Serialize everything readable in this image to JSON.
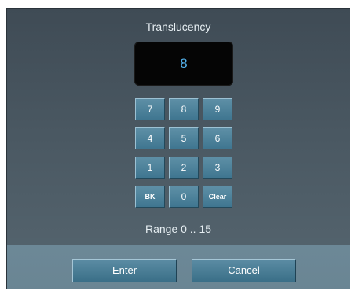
{
  "dialog": {
    "title": "Translucency",
    "display_value": "8",
    "range_text": "Range 0 .. 15"
  },
  "keypad": {
    "keys": [
      "7",
      "8",
      "9",
      "4",
      "5",
      "6",
      "1",
      "2",
      "3",
      "BK",
      "0",
      "Clear"
    ]
  },
  "footer": {
    "enter_label": "Enter",
    "cancel_label": "Cancel"
  },
  "colors": {
    "display_text": "#55b4ee",
    "key_face": "#4c8199",
    "dialog_background": "#4a5862",
    "footer_background": "#6c8897"
  }
}
